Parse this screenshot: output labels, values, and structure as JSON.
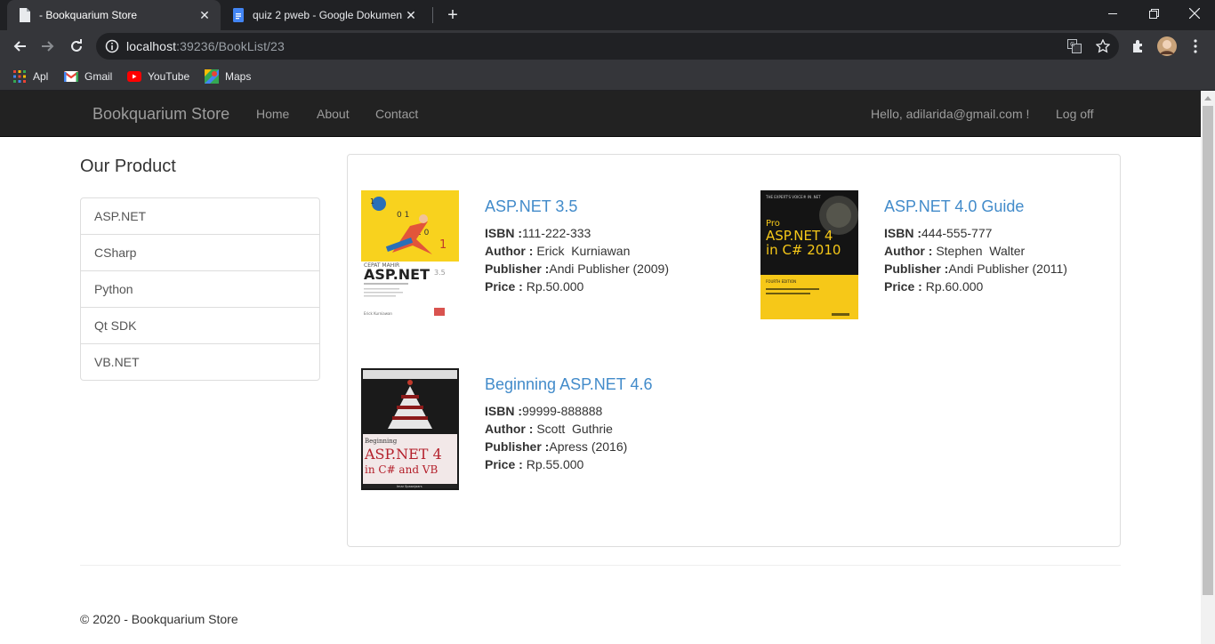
{
  "browser": {
    "tabs": [
      {
        "title": " - Bookquarium Store",
        "active": true
      },
      {
        "title": "quiz 2 pweb - Google Dokumen",
        "active": false
      }
    ],
    "url_host": "localhost",
    "url_path": ":39236/BookList/23",
    "bookmarks": [
      "Apl",
      "Gmail",
      "YouTube",
      "Maps"
    ]
  },
  "navbar": {
    "brand": "Bookquarium Store",
    "links": [
      "Home",
      "About",
      "Contact"
    ],
    "greeting": "Hello, adilarida@gmail.com !",
    "logoff": "Log off"
  },
  "sidebar": {
    "title": "Our Product",
    "categories": [
      "ASP.NET",
      "CSharp",
      "Python",
      "Qt SDK",
      "VB.NET"
    ]
  },
  "labels": {
    "isbn": "ISBN :",
    "author": "Author : ",
    "publisher": "Publisher :",
    "price": "Price : "
  },
  "books": [
    {
      "title": "ASP.NET 3.5",
      "isbn": "111-222-333",
      "author": "Erick  Kurniawan",
      "publisher": "Andi Publisher (2009)",
      "price": "Rp.50.000",
      "cover": {
        "top_text": "CEPAT MAHIR",
        "big_text": "ASP.NET",
        "small_text": "3.5",
        "author_text": "Erick Kurniawan"
      }
    },
    {
      "title": "ASP.NET 4.0 Guide",
      "isbn": "444-555-777",
      "author": "Stephen  Walter",
      "publisher": "Andi Publisher (2011)",
      "price": "Rp.60.000",
      "cover": {
        "top_text": "THE EXPERT'S VOICE® IN .NET",
        "big_text": "Pro",
        "line2": "ASP.NET 4",
        "line3": "in C# 2010",
        "edition": "FOURTH EDITION"
      }
    },
    {
      "title": "Beginning ASP.NET 4.6",
      "isbn": "99999-888888",
      "author": "Scott  Guthrie",
      "publisher": "Apress (2016)",
      "price": "Rp.55.000",
      "cover": {
        "big_text": "Beginning",
        "line2": "ASP.NET 4",
        "line3": "in C# and VB",
        "author_text": "Imar Spaanjaars"
      }
    }
  ],
  "footer": "© 2020 - Bookquarium Store",
  "colors": {
    "navbar": "#222222",
    "link": "#428bca",
    "chrome_dark": "#202124",
    "chrome": "#35363a"
  }
}
